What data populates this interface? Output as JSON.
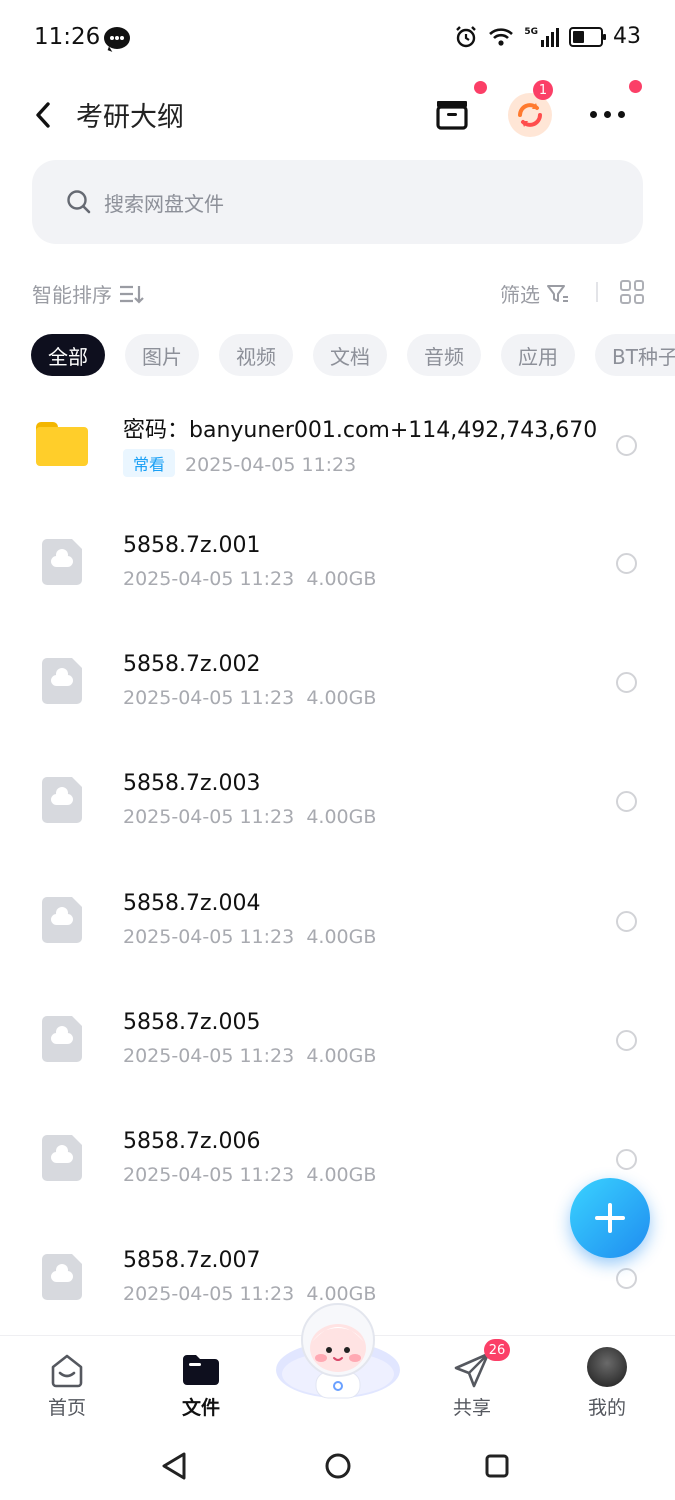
{
  "status_bar": {
    "time": "11:26",
    "battery": "43"
  },
  "header": {
    "title": "考研大纲",
    "sync_badge": "1"
  },
  "search": {
    "placeholder": "搜索网盘文件"
  },
  "toolbar": {
    "sort_label": "智能排序",
    "filter_label": "筛选"
  },
  "chips": [
    "全部",
    "图片",
    "视频",
    "文档",
    "音频",
    "应用",
    "BT种子"
  ],
  "files": [
    {
      "name": "密码：banyuner001.com+114,492,743,670",
      "tag": "常看",
      "date": "2025-04-05  11:23",
      "size": "",
      "type": "folder"
    },
    {
      "name": "5858.7z.001",
      "date": "2025-04-05  11:23",
      "size": "4.00GB",
      "type": "file"
    },
    {
      "name": "5858.7z.002",
      "date": "2025-04-05  11:23",
      "size": "4.00GB",
      "type": "file"
    },
    {
      "name": "5858.7z.003",
      "date": "2025-04-05  11:23",
      "size": "4.00GB",
      "type": "file"
    },
    {
      "name": "5858.7z.004",
      "date": "2025-04-05  11:23",
      "size": "4.00GB",
      "type": "file"
    },
    {
      "name": "5858.7z.005",
      "date": "2025-04-05  11:23",
      "size": "4.00GB",
      "type": "file"
    },
    {
      "name": "5858.7z.006",
      "date": "2025-04-05  11:23",
      "size": "4.00GB",
      "type": "file"
    },
    {
      "name": "5858.7z.007",
      "date": "2025-04-05  11:23",
      "size": "4.00GB",
      "type": "file"
    }
  ],
  "bottom_nav": {
    "home": "首页",
    "files": "文件",
    "share": "共享",
    "share_badge": "26",
    "mine": "我的"
  },
  "colors": {
    "accent": "#1f8cf0",
    "badge": "#fb3f67",
    "folder": "#ffce2a"
  }
}
